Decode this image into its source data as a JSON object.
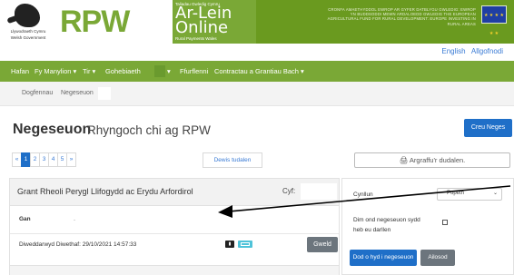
{
  "header": {
    "gov_line1": "Llywodraeth Cymru",
    "gov_line2": "Welsh Government",
    "rpw": "RPW",
    "brand_top": "Taliadau Gwledig Cymru",
    "brand_line1": "Ar-Lein",
    "brand_line2": "Online",
    "brand_bottom": "Rural Payments Wales",
    "eu_text": "CRONFA AMAETHYDDOL EWROP AR GYFER DATBLYGU GWLEDIG: EWROP YN BUDDSODDI MEWN ARDALOEDD GWLEDIG THE EUROPEAN AGRICULTURAL FUND FOR RURAL DEVELOPMENT: EUROPE INVESTING IN RURAL AREAS",
    "eu_stars": "★ ★ ★ ★ ★ ★"
  },
  "utility": {
    "english": "English",
    "logout": "Allgofnodi"
  },
  "nav": {
    "items": [
      "Hafan",
      "Fy Manylion ▾",
      "Tir ▾",
      "Gohebiaeth",
      "▾",
      "Ffurflenni",
      "Contractau a Grantiau Bach ▾"
    ]
  },
  "breadcrumb": {
    "items": [
      "Dogfennau",
      "Negeseuon"
    ]
  },
  "page": {
    "title": "Negeseuon",
    "subtitle": "Rhyngoch chi ag RPW",
    "new_button": "Creu Neges"
  },
  "pagination": {
    "prev": "«",
    "pages": [
      "1",
      "2",
      "3",
      "4",
      "5"
    ],
    "next": "»",
    "goto_label": "Dewis tudalen"
  },
  "print_button": "🖨 Argraffu'r dudalen.",
  "message": {
    "title": "Grant Rheoli Perygl Llifogydd ac Erydu Arfordirol",
    "ref_label": "Cyf:",
    "from_label": "Gan",
    "from_value": "-",
    "updated": "Diweddarwyd Diwethaf: 29/10/2021 14:57:33",
    "view_button": "Gweld"
  },
  "filter": {
    "scheme_label": "Cynllun",
    "scheme_value": "Popeth",
    "scheme_chevron": "⌄",
    "unread_label": "Dim ond negeseuon sydd heb eu darllen",
    "search_button": "Dod o hyd i negeseuon",
    "reset_button": "Ailosod"
  },
  "colors": {
    "brand_green": "#7aa836",
    "primary_blue": "#1f6fc8",
    "secondary_gray": "#6c757d"
  }
}
